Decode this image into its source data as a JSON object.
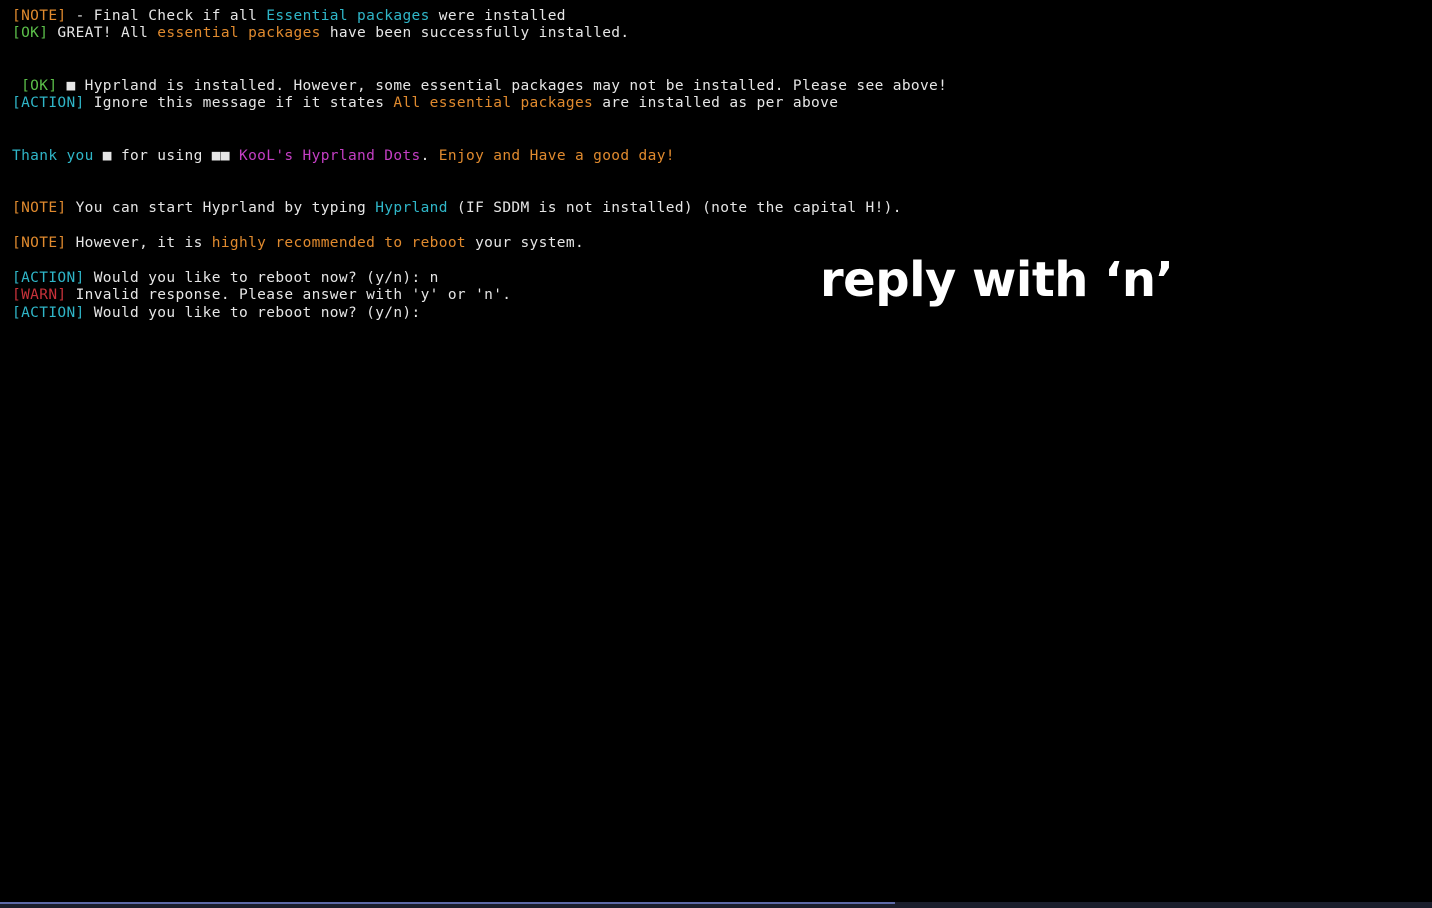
{
  "terminal": {
    "lines": [
      [
        [
          "[NOTE]",
          "orange"
        ],
        [
          " - Final Check if all ",
          "text"
        ],
        [
          "Essential packages",
          "cyan"
        ],
        [
          " were installed",
          "text"
        ]
      ],
      [
        [
          "[OK]",
          "green"
        ],
        [
          " GREAT! All ",
          "text"
        ],
        [
          "essential packages",
          "orange"
        ],
        [
          " have been successfully installed.",
          "text"
        ]
      ],
      [
        [
          " [OK]",
          "green"
        ],
        [
          " ■ Hyprland is installed. However, some essential packages may not be installed. Please see above!",
          "text"
        ]
      ],
      [
        [
          "[ACTION]",
          "cyan"
        ],
        [
          " Ignore this message if it states ",
          "text"
        ],
        [
          "All essential packages",
          "orange"
        ],
        [
          " are installed as per above",
          "text"
        ]
      ],
      [
        [
          "Thank you",
          "cyan"
        ],
        [
          " ■ for using ■■ ",
          "text"
        ],
        [
          "KooL's Hyprland Dots",
          "magenta"
        ],
        [
          ". ",
          "text"
        ],
        [
          "Enjoy and Have a good day!",
          "orange"
        ]
      ],
      [
        [
          "[NOTE]",
          "orange"
        ],
        [
          " You can start Hyprland by typing ",
          "text"
        ],
        [
          "Hyprland",
          "cyan"
        ],
        [
          " (IF SDDM is not installed) (note the capital H!).",
          "text"
        ]
      ],
      [
        [
          "[NOTE]",
          "orange"
        ],
        [
          " However, it is ",
          "text"
        ],
        [
          "highly recommended to reboot",
          "orange"
        ],
        [
          " your system.",
          "text"
        ]
      ],
      [
        [
          "[ACTION]",
          "cyan"
        ],
        [
          " Would you like to reboot now? (y/n): n",
          "text"
        ]
      ],
      [
        [
          "[WARN]",
          "red"
        ],
        [
          " Invalid response. Please answer with 'y' or 'n'.",
          "text"
        ]
      ],
      [
        [
          "[ACTION]",
          "cyan"
        ],
        [
          " Would you like to reboot now? (y/n):",
          "text"
        ]
      ]
    ]
  },
  "overlay": {
    "caption": "reply with ‘n’"
  },
  "progress": {
    "fraction": 0.625
  },
  "colors": {
    "background": "#000000",
    "text": "#d6d6d6",
    "orange": "#e08a2e",
    "green": "#5cc04a",
    "cyan": "#2fb6c8",
    "magenta": "#c43fc4",
    "red": "#c8323a",
    "progress": "#5e6aa8"
  }
}
